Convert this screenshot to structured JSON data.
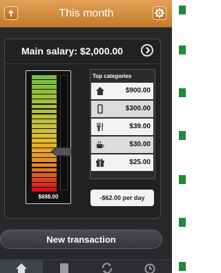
{
  "header": {
    "title": "This month",
    "back_icon": "arrow-up-icon",
    "settings_icon": "gear-icon"
  },
  "summary": {
    "salary_label": "Main salary: $2,000.00"
  },
  "gauge": {
    "spent_label": "$698.00",
    "level_fraction": 0.35
  },
  "categories": {
    "heading": "Top categories",
    "items": [
      {
        "icon": "home-icon",
        "amount": "$900.00"
      },
      {
        "icon": "phone-icon",
        "amount": "$300.00"
      },
      {
        "icon": "fork-knife-icon",
        "amount": "$39.00"
      },
      {
        "icon": "coffee-icon",
        "amount": "$30.00"
      },
      {
        "icon": "gift-icon",
        "amount": "$25.00"
      }
    ]
  },
  "per_day": "-$62.00 per day",
  "actions": {
    "new_transaction": "New transaction"
  },
  "tabs": [
    {
      "icon": "home-icon",
      "active": true
    },
    {
      "icon": "receipt-icon",
      "active": false
    },
    {
      "icon": "sync-icon",
      "active": false
    },
    {
      "icon": "clock-icon",
      "active": false
    }
  ],
  "colors": {
    "accent": "#d08a3b",
    "background": "#26282a",
    "side_marks": "#1f8b3a"
  }
}
